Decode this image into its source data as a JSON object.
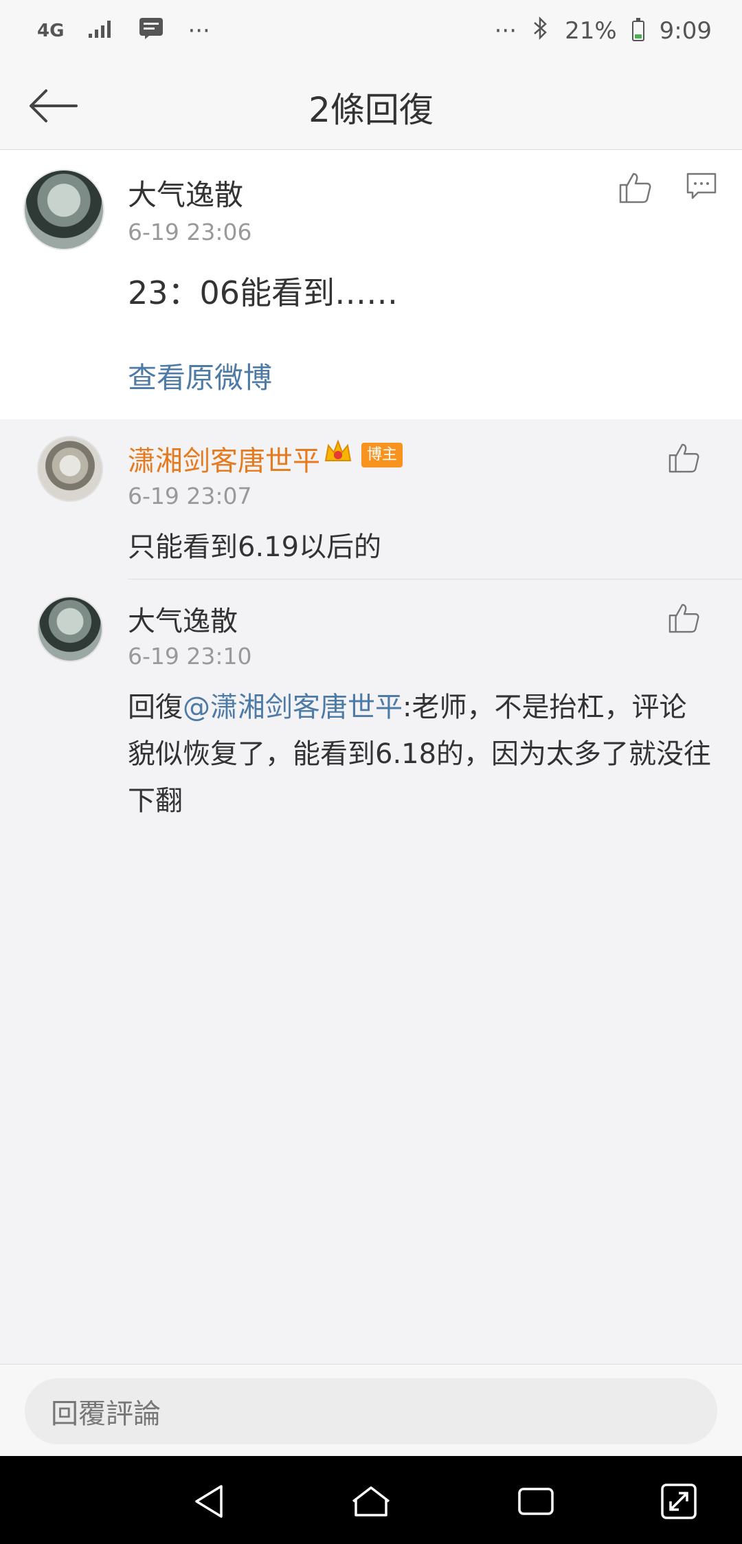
{
  "status_bar": {
    "network": "4G",
    "signal_icon": "signal-bars-icon",
    "notification_icon": "message-icon",
    "left_more": "···",
    "right_more": "···",
    "bluetooth_icon": "bluetooth-icon",
    "battery_percent": "21%",
    "time": "9:09"
  },
  "header": {
    "back_icon": "arrow-left-icon",
    "title": "2條回復"
  },
  "main_comment": {
    "user": "大气逸散",
    "time": "6-19 23:06",
    "text": "23：06能看到……",
    "view_original": "查看原微博",
    "like_icon": "thumbs-up-icon",
    "reply_icon": "comment-icon"
  },
  "replies": [
    {
      "user": "潇湘剑客唐世平",
      "badge": "博主",
      "time": "6-19 23:07",
      "text": "只能看到6.19以后的"
    },
    {
      "user": "大气逸散",
      "time": "6-19 23:10",
      "prefix": "回復",
      "mention": "@潇湘剑客唐世平",
      "text": ":老师，不是抬杠，评论貌似恢复了，能看到6.18的，因为太多了就没往下翻"
    }
  ],
  "input": {
    "placeholder": "回覆評論"
  },
  "colors": {
    "link": "#4e7aa6",
    "blogger_name": "#e67a1e",
    "badge": "#f7931e"
  }
}
